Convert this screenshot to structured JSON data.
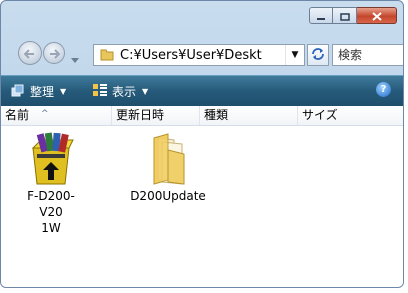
{
  "window": {
    "buttons": {
      "minimize": "minimize-icon",
      "maximize": "maximize-icon",
      "close": "close-icon"
    }
  },
  "address_bar": {
    "path": "C:¥Users¥User¥Deskt",
    "search_placeholder": "検索"
  },
  "toolbar": {
    "organize_label": "整理",
    "views_label": "表示",
    "help_label": "?"
  },
  "columns": [
    "名前",
    "更新日時",
    "種類",
    "サイズ"
  ],
  "files": [
    {
      "name_line1": "F-D200-V20",
      "name_line2": "1W",
      "icon": "installer-archive-icon"
    },
    {
      "name_line1": "D200Update",
      "name_line2": "",
      "icon": "folder-icon"
    }
  ],
  "colors": {
    "toolbar": "#265a7a",
    "window_frame": "#c8dcee",
    "close_button": "#c4472c"
  }
}
